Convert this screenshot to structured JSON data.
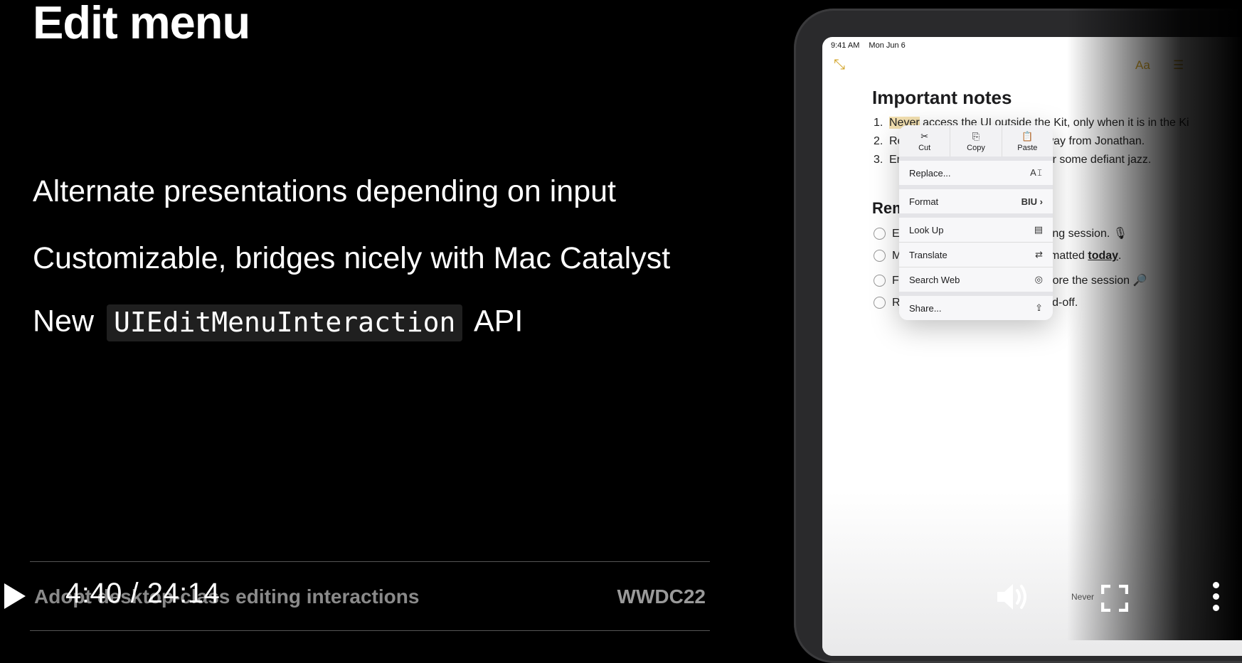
{
  "slide": {
    "title": "Edit menu",
    "bullets": [
      "Alternate presentations depending on input",
      "Customizable, bridges nicely with Mac Catalyst"
    ],
    "bullet3_prefix": "New",
    "bullet3_code": "UIEditMenuInteraction",
    "bullet3_suffix": "API",
    "footer_left": "Adopt desktop-class editing interactions",
    "footer_right": "WWDC22"
  },
  "ipad": {
    "status_time": "9:41 AM",
    "status_date": "Mon Jun 6",
    "note_title": "Important notes",
    "lines": [
      {
        "num": "1.",
        "highlight": "Never",
        "rest": " access the UI outside the Kit, only when it is in the Ki"
      },
      {
        "num": "2.",
        "text_start": "Re",
        "text_end": "pe away from Jonathan."
      },
      {
        "num": "3.",
        "text_start": "Er",
        "text_end": "ady for some defiant jazz."
      }
    ],
    "section_heading": "Rem",
    "todos": [
      {
        "start": "Ec",
        "end": "cording session. 🎙"
      },
      {
        "start": "M",
        "end": "formatted ",
        "underline": "today",
        "after": "."
      },
      {
        "start": "Fi",
        "end": "before the session 🔎"
      },
      {
        "start": "Re",
        "end": "hand-off."
      }
    ],
    "edit_menu": {
      "actions": [
        {
          "icon": "✂",
          "label": "Cut"
        },
        {
          "icon": "⎘",
          "label": "Copy"
        },
        {
          "icon": "📋",
          "label": "Paste"
        }
      ],
      "rows": [
        {
          "label": "Replace...",
          "icon": "A𝙸"
        },
        {
          "label": "Format",
          "icon": "BIU ›"
        },
        {
          "label": "Look Up",
          "icon": "▤"
        },
        {
          "label": "Translate",
          "icon": "⇄"
        },
        {
          "label": "Search Web",
          "icon": "◎"
        },
        {
          "label": "Share...",
          "icon": "⇪"
        }
      ]
    },
    "keyboard_bar_text": "Never"
  },
  "player": {
    "timecode": "4:40 / 24:14"
  }
}
